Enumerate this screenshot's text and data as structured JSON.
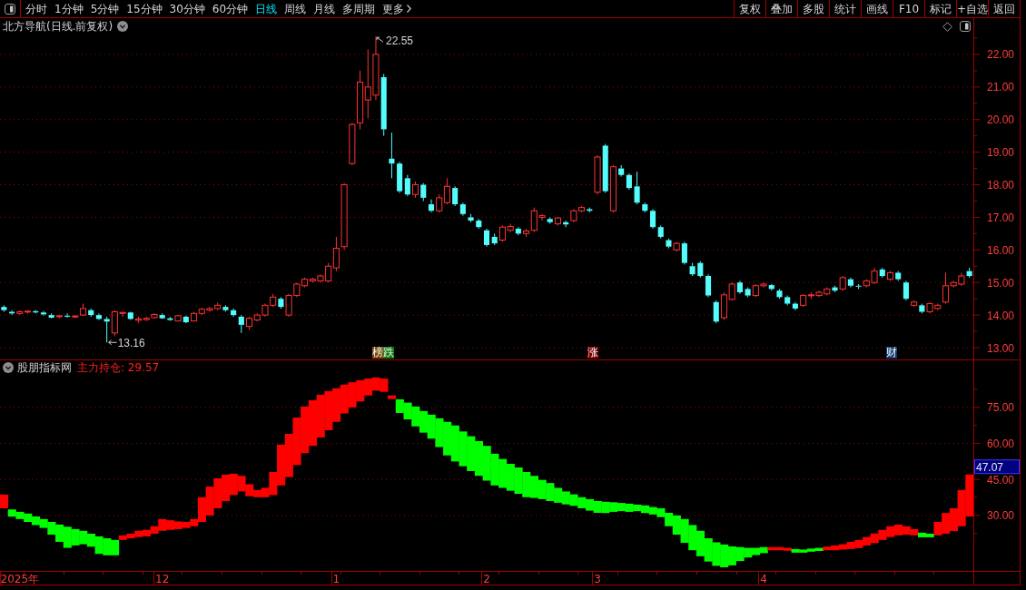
{
  "toolbar": {
    "periods": [
      {
        "label": "分时",
        "kind": "period",
        "selected": false
      },
      {
        "label": "1分钟",
        "kind": "period",
        "selected": false
      },
      {
        "label": "5分钟",
        "kind": "period",
        "selected": false
      },
      {
        "label": "15分钟",
        "kind": "period",
        "selected": false
      },
      {
        "label": "30分钟",
        "kind": "period",
        "selected": false
      },
      {
        "label": "60分钟",
        "kind": "period",
        "selected": false
      },
      {
        "label": "日线",
        "kind": "period",
        "selected": true
      },
      {
        "label": "周线",
        "kind": "period",
        "selected": false
      },
      {
        "label": "月线",
        "kind": "period",
        "selected": false
      },
      {
        "label": "多周期",
        "kind": "period",
        "selected": false
      },
      {
        "label": "更多",
        "kind": "more",
        "selected": false
      }
    ],
    "buttons": [
      "复权",
      "叠加",
      "多股",
      "统计",
      "画线",
      "F10",
      "标记",
      "+自选",
      "返回"
    ]
  },
  "price_pane": {
    "title": "北方导航(日线.前复权)",
    "event_tags": [
      {
        "label": "榜",
        "color": "#7b4a12"
      },
      {
        "label": "跌",
        "color": "#0b7d0b"
      },
      {
        "label": "涨",
        "color": "#780000"
      },
      {
        "label": "财",
        "color": "#0d3a6e"
      }
    ],
    "chart_data": [
      {
        "type": "candlestick",
        "grid": true,
        "ylim": [
          12.61,
          23.14
        ],
        "yticks": [
          {
            "value": 13,
            "label": "13.00"
          },
          {
            "value": 14,
            "label": "14.00"
          },
          {
            "value": 15,
            "label": "15.00"
          },
          {
            "value": 16,
            "label": "16.00"
          },
          {
            "value": 17,
            "label": "17.00"
          },
          {
            "value": 18,
            "label": "18.00"
          },
          {
            "value": 19,
            "label": "19.00"
          },
          {
            "value": 20,
            "label": "20.00"
          },
          {
            "value": 21,
            "label": "21.00"
          },
          {
            "value": 22,
            "label": "22.00"
          }
        ],
        "annotations": [
          "22.55",
          "13.16"
        ],
        "ohlc": [
          [
            14.25,
            14.3,
            14.1,
            14.15
          ],
          [
            14.1,
            14.15,
            14.0,
            14.05
          ],
          [
            14.05,
            14.15,
            14.0,
            14.1
          ],
          [
            14.1,
            14.15,
            14.05,
            14.12
          ],
          [
            14.12,
            14.15,
            14.05,
            14.08
          ],
          [
            14.08,
            14.12,
            13.98,
            14.02
          ],
          [
            14.0,
            14.05,
            13.9,
            13.92
          ],
          [
            13.95,
            14.0,
            13.9,
            13.98
          ],
          [
            13.98,
            14.05,
            13.92,
            13.95
          ],
          [
            13.95,
            14.0,
            13.9,
            13.97
          ],
          [
            14.0,
            14.35,
            13.98,
            14.2
          ],
          [
            14.15,
            14.2,
            13.95,
            14.0
          ],
          [
            14.0,
            14.05,
            13.85,
            13.88
          ],
          [
            13.88,
            13.95,
            13.16,
            13.8
          ],
          [
            13.45,
            14.15,
            13.35,
            14.1
          ],
          [
            14.05,
            14.1,
            13.95,
            14.08
          ],
          [
            14.08,
            14.1,
            13.85,
            13.88
          ],
          [
            13.84,
            13.95,
            13.76,
            13.88
          ],
          [
            13.86,
            13.95,
            13.82,
            13.9
          ],
          [
            13.92,
            14.05,
            13.9,
            14.02
          ],
          [
            14.0,
            14.05,
            13.88,
            13.9
          ],
          [
            13.9,
            13.95,
            13.82,
            13.85
          ],
          [
            13.82,
            14.0,
            13.8,
            13.98
          ],
          [
            13.95,
            13.98,
            13.75,
            13.78
          ],
          [
            13.82,
            14.1,
            13.8,
            14.05
          ],
          [
            14.05,
            14.22,
            14.0,
            14.18
          ],
          [
            14.15,
            14.25,
            14.1,
            14.2
          ],
          [
            14.2,
            14.38,
            14.15,
            14.3
          ],
          [
            14.25,
            14.3,
            14.1,
            14.15
          ],
          [
            14.15,
            14.2,
            13.95,
            14.0
          ],
          [
            13.95,
            14.0,
            13.45,
            13.7
          ],
          [
            13.65,
            13.95,
            13.55,
            13.9
          ],
          [
            13.85,
            14.05,
            13.8,
            14.0
          ],
          [
            14.0,
            14.35,
            13.95,
            14.3
          ],
          [
            14.3,
            14.65,
            14.25,
            14.55
          ],
          [
            14.5,
            14.55,
            14.2,
            14.25
          ],
          [
            14.0,
            14.65,
            13.95,
            14.6
          ],
          [
            14.6,
            15.0,
            14.55,
            14.95
          ],
          [
            14.9,
            15.15,
            14.85,
            15.1
          ],
          [
            15.05,
            15.15,
            15.0,
            15.1
          ],
          [
            15.05,
            15.25,
            15.0,
            15.2
          ],
          [
            15.05,
            15.6,
            15.0,
            15.5
          ],
          [
            15.45,
            16.4,
            15.35,
            16.05
          ],
          [
            16.1,
            18.05,
            16.0,
            18.0
          ],
          [
            18.65,
            19.9,
            18.6,
            19.85
          ],
          [
            19.9,
            21.5,
            19.7,
            21.15
          ],
          [
            20.6,
            22.15,
            20.05,
            21.0
          ],
          [
            20.75,
            22.55,
            20.6,
            22.0
          ],
          [
            21.3,
            21.4,
            19.5,
            19.7
          ],
          [
            18.8,
            19.6,
            18.2,
            18.65
          ],
          [
            18.65,
            18.7,
            17.75,
            17.8
          ],
          [
            18.2,
            18.3,
            17.65,
            17.7
          ],
          [
            17.7,
            18.1,
            17.6,
            18.0
          ],
          [
            18.0,
            18.05,
            17.5,
            17.6
          ],
          [
            17.4,
            17.55,
            17.15,
            17.2
          ],
          [
            17.2,
            17.7,
            17.15,
            17.6
          ],
          [
            17.45,
            18.2,
            17.4,
            17.95
          ],
          [
            17.9,
            17.95,
            17.35,
            17.4
          ],
          [
            17.4,
            17.45,
            17.05,
            17.1
          ],
          [
            17.0,
            17.1,
            16.85,
            16.9
          ],
          [
            16.9,
            16.95,
            16.65,
            16.7
          ],
          [
            16.6,
            16.65,
            16.1,
            16.15
          ],
          [
            16.4,
            16.5,
            16.15,
            16.2
          ],
          [
            16.3,
            16.75,
            16.25,
            16.7
          ],
          [
            16.6,
            16.8,
            16.55,
            16.72
          ],
          [
            16.65,
            16.7,
            16.45,
            16.5
          ],
          [
            16.5,
            16.65,
            16.4,
            16.58
          ],
          [
            16.6,
            17.3,
            16.55,
            17.2
          ],
          [
            17.0,
            17.1,
            16.9,
            17.05
          ],
          [
            16.95,
            17.0,
            16.8,
            16.85
          ],
          [
            16.8,
            17.0,
            16.75,
            16.98
          ],
          [
            16.85,
            16.9,
            16.7,
            16.78
          ],
          [
            16.9,
            17.25,
            16.85,
            17.2
          ],
          [
            17.2,
            17.35,
            17.15,
            17.3
          ],
          [
            17.25,
            17.3,
            17.15,
            17.2
          ],
          [
            17.77,
            18.9,
            17.7,
            18.85
          ],
          [
            19.2,
            19.25,
            17.75,
            17.8
          ],
          [
            17.2,
            18.6,
            17.15,
            18.55
          ],
          [
            18.5,
            18.6,
            18.25,
            18.3
          ],
          [
            18.3,
            18.35,
            17.85,
            17.9
          ],
          [
            17.95,
            18.4,
            17.4,
            17.45
          ],
          [
            17.4,
            17.45,
            17.15,
            17.2
          ],
          [
            17.2,
            17.25,
            16.65,
            16.7
          ],
          [
            16.7,
            16.75,
            16.35,
            16.4
          ],
          [
            16.3,
            16.35,
            16.05,
            16.1
          ],
          [
            16.0,
            16.25,
            15.95,
            16.2
          ],
          [
            16.2,
            16.25,
            15.55,
            15.6
          ],
          [
            15.5,
            15.6,
            15.2,
            15.25
          ],
          [
            15.6,
            15.65,
            15.15,
            15.2
          ],
          [
            15.2,
            15.25,
            14.55,
            14.6
          ],
          [
            14.4,
            14.45,
            13.75,
            13.8
          ],
          [
            13.92,
            14.7,
            13.85,
            14.62
          ],
          [
            14.48,
            15.0,
            14.45,
            14.95
          ],
          [
            15.0,
            15.05,
            14.65,
            14.7
          ],
          [
            14.8,
            14.85,
            14.55,
            14.6
          ],
          [
            14.6,
            14.95,
            14.55,
            14.9
          ],
          [
            14.9,
            15.0,
            14.85,
            14.95
          ],
          [
            14.92,
            14.95,
            14.75,
            14.8
          ],
          [
            14.75,
            14.8,
            14.5,
            14.55
          ],
          [
            14.55,
            14.6,
            14.3,
            14.35
          ],
          [
            14.35,
            14.4,
            14.15,
            14.2
          ],
          [
            14.3,
            14.65,
            14.25,
            14.6
          ],
          [
            14.6,
            14.7,
            14.5,
            14.62
          ],
          [
            14.6,
            14.75,
            14.55,
            14.7
          ],
          [
            14.65,
            14.85,
            14.6,
            14.8
          ],
          [
            14.85,
            14.9,
            14.7,
            14.75
          ],
          [
            14.8,
            15.2,
            14.75,
            15.15
          ],
          [
            15.1,
            15.15,
            14.85,
            14.9
          ],
          [
            14.9,
            14.95,
            14.8,
            14.88
          ],
          [
            14.9,
            15.1,
            14.85,
            15.05
          ],
          [
            15.0,
            15.45,
            14.95,
            15.35
          ],
          [
            15.4,
            15.45,
            15.15,
            15.2
          ],
          [
            15.1,
            15.35,
            15.05,
            15.3
          ],
          [
            15.3,
            15.35,
            15.05,
            15.1
          ],
          [
            15.0,
            15.05,
            14.45,
            14.5
          ],
          [
            14.3,
            14.45,
            14.25,
            14.4
          ],
          [
            14.3,
            14.35,
            14.05,
            14.1
          ],
          [
            14.1,
            14.4,
            14.05,
            14.35
          ],
          [
            14.2,
            14.35,
            14.15,
            14.3
          ],
          [
            14.4,
            15.3,
            14.35,
            14.9
          ],
          [
            14.9,
            15.05,
            14.85,
            15.0
          ],
          [
            14.95,
            15.3,
            14.9,
            15.2
          ],
          [
            15.35,
            15.45,
            15.15,
            15.2
          ]
        ]
      }
    ]
  },
  "indicator_pane": {
    "title": "股朋指标网",
    "legend": "主力持仓: 29.57",
    "current_value": "47.07",
    "chart_data": [
      {
        "type": "bar",
        "grid": true,
        "ylim": [
          6.5,
          95.0
        ],
        "yticks": [
          {
            "value": 30,
            "label": "30.00"
          },
          {
            "value": 45,
            "label": "45.00"
          },
          {
            "value": 60,
            "label": "60.00"
          },
          {
            "value": 75,
            "label": "75.00"
          }
        ],
        "categories": [
          null,
          null,
          "2025年",
          null,
          null,
          null,
          null,
          null,
          null,
          null,
          null,
          null,
          null,
          null,
          null,
          null,
          null,
          null,
          null,
          null,
          "12",
          null,
          null,
          null,
          null,
          null,
          null,
          null,
          null,
          null,
          null,
          null,
          null,
          null,
          null,
          null,
          null,
          null,
          null,
          null,
          null,
          null,
          "1",
          null,
          null,
          null,
          null,
          null,
          null,
          null,
          null,
          null,
          null,
          null,
          null,
          null,
          null,
          null,
          null,
          null,
          null,
          "2",
          null,
          null,
          null,
          null,
          null,
          null,
          null,
          null,
          null,
          null,
          null,
          null,
          null,
          "3",
          null,
          null,
          null,
          null,
          null,
          null,
          null,
          null,
          null,
          null,
          null,
          null,
          null,
          null,
          null,
          null,
          null,
          null,
          null,
          null,
          "4",
          null,
          null,
          null,
          null,
          null,
          null,
          null,
          null,
          null,
          null,
          null,
          null,
          null,
          null,
          null,
          null,
          null,
          null,
          null,
          null,
          null,
          null,
          null,
          null,
          null,
          null
        ],
        "base": [
          33.0,
          29.5,
          28.5,
          27.3,
          26.0,
          24.8,
          22.0,
          19.0,
          16.5,
          17.5,
          18.0,
          17.0,
          14.0,
          13.4,
          13.4,
          19.8,
          20.5,
          21.0,
          21.3,
          22.4,
          23.6,
          24.0,
          24.3,
          24.8,
          25.5,
          27.3,
          30.0,
          33.0,
          36.0,
          38.5,
          40.0,
          38.0,
          37.6,
          37.6,
          38.5,
          42.5,
          46.0,
          51.0,
          56.0,
          59.0,
          62.5,
          65.5,
          69.0,
          72.5,
          75.0,
          77.5,
          80.0,
          82.0,
          81.5,
          78.5,
          72.7,
          70.0,
          67.1,
          64.5,
          62.0,
          58.5,
          55.0,
          52.5,
          50.5,
          48.5,
          46.5,
          44.5,
          42.5,
          41.5,
          40.3,
          39.0,
          37.6,
          37.3,
          36.8,
          36.0,
          35.3,
          34.6,
          34.0,
          33.0,
          32.0,
          31.1,
          31.0,
          31.5,
          31.8,
          31.5,
          31.8,
          31.0,
          30.4,
          29.3,
          25.5,
          22.0,
          18.6,
          15.5,
          13.0,
          10.8,
          9.0,
          8.4,
          9.2,
          11.0,
          12.5,
          13.5,
          14.3,
          15.5,
          15.5,
          15.3,
          14.5,
          14.5,
          14.9,
          15.2,
          15.5,
          15.5,
          15.8,
          16.0,
          16.4,
          17.5,
          18.5,
          19.8,
          21.0,
          21.7,
          22.0,
          21.7,
          20.9,
          20.9,
          21.7,
          22.4,
          23.5,
          25.5,
          29.57
        ],
        "values": [
          5.7,
          3.0,
          3.0,
          3.5,
          3.6,
          3.7,
          5.3,
          7.2,
          8.8,
          6.8,
          5.6,
          5.4,
          7.3,
          7.1,
          6.4,
          1.9,
          1.9,
          2.6,
          2.7,
          3.1,
          4.9,
          4.0,
          3.2,
          2.5,
          3.0,
          10.3,
          12.0,
          12.5,
          11.0,
          8.9,
          6.5,
          5.0,
          3.0,
          3.9,
          9.6,
          17.0,
          18.0,
          19.8,
          19.4,
          19.0,
          17.8,
          16.3,
          14.0,
          12.0,
          10.5,
          8.8,
          7.0,
          5.5,
          5.5,
          1.5,
          5.7,
          7.0,
          8.3,
          9.0,
          10.0,
          12.0,
          14.0,
          15.0,
          14.5,
          14.5,
          14.5,
          14.5,
          13.2,
          12.0,
          11.2,
          11.0,
          10.5,
          9.2,
          8.0,
          7.5,
          6.2,
          5.4,
          4.8,
          4.6,
          4.8,
          4.9,
          4.7,
          4.0,
          3.4,
          3.4,
          2.7,
          3.2,
          3.1,
          3.7,
          5.6,
          8.0,
          9.9,
          10.5,
          10.6,
          9.7,
          9.8,
          9.5,
          7.9,
          5.8,
          4.0,
          3.0,
          2.5,
          1.3,
          1.3,
          1.2,
          1.5,
          1.3,
          1.3,
          1.3,
          1.5,
          2.0,
          2.2,
          3.0,
          3.4,
          3.5,
          4.0,
          4.2,
          4.5,
          4.5,
          3.5,
          2.6,
          1.9,
          1.5,
          5.6,
          8.6,
          9.5,
          15.1,
          17.5
        ],
        "colors": [
          "#ff0000",
          "#00ff00",
          "#00ff00",
          "#00ff00",
          "#00ff00",
          "#00ff00",
          "#00ff00",
          "#00ff00",
          "#00ff00",
          "#00ff00",
          "#00ff00",
          "#00ff00",
          "#00ff00",
          "#00ff00",
          "#00ff00",
          "#ff0000",
          "#ff0000",
          "#ff0000",
          "#ff0000",
          "#ff0000",
          "#ff0000",
          "#ff0000",
          "#ff0000",
          "#ff0000",
          "#ff0000",
          "#ff0000",
          "#ff0000",
          "#ff0000",
          "#ff0000",
          "#ff0000",
          "#ff0000",
          "#ff0000",
          "#ff0000",
          "#ff0000",
          "#ff0000",
          "#ff0000",
          "#ff0000",
          "#ff0000",
          "#ff0000",
          "#ff0000",
          "#ff0000",
          "#ff0000",
          "#ff0000",
          "#ff0000",
          "#ff0000",
          "#ff0000",
          "#ff0000",
          "#ff0000",
          "#ff0000",
          "#ff0000",
          "#00ff00",
          "#00ff00",
          "#00ff00",
          "#00ff00",
          "#00ff00",
          "#00ff00",
          "#00ff00",
          "#00ff00",
          "#00ff00",
          "#00ff00",
          "#00ff00",
          "#00ff00",
          "#00ff00",
          "#00ff00",
          "#00ff00",
          "#00ff00",
          "#00ff00",
          "#00ff00",
          "#00ff00",
          "#00ff00",
          "#00ff00",
          "#00ff00",
          "#00ff00",
          "#00ff00",
          "#00ff00",
          "#00ff00",
          "#00ff00",
          "#00ff00",
          "#00ff00",
          "#00ff00",
          "#00ff00",
          "#00ff00",
          "#00ff00",
          "#00ff00",
          "#00ff00",
          "#00ff00",
          "#00ff00",
          "#00ff00",
          "#00ff00",
          "#00ff00",
          "#00ff00",
          "#00ff00",
          "#00ff00",
          "#00ff00",
          "#00ff00",
          "#00ff00",
          "#00ff00",
          "#ff0000",
          "#ff0000",
          "#ff0000",
          "#00ff00",
          "#00ff00",
          "#00ff00",
          "#00ff00",
          "#ff0000",
          "#ff0000",
          "#ff0000",
          "#ff0000",
          "#ff0000",
          "#ff0000",
          "#ff0000",
          "#ff0000",
          "#ff0000",
          "#ff0000",
          "#ff0000",
          "#ff0000",
          "#00ff00",
          "#00ff00",
          "#ff0000",
          "#ff0000",
          "#ff0000",
          "#ff0000",
          "#ff0000"
        ]
      }
    ]
  }
}
